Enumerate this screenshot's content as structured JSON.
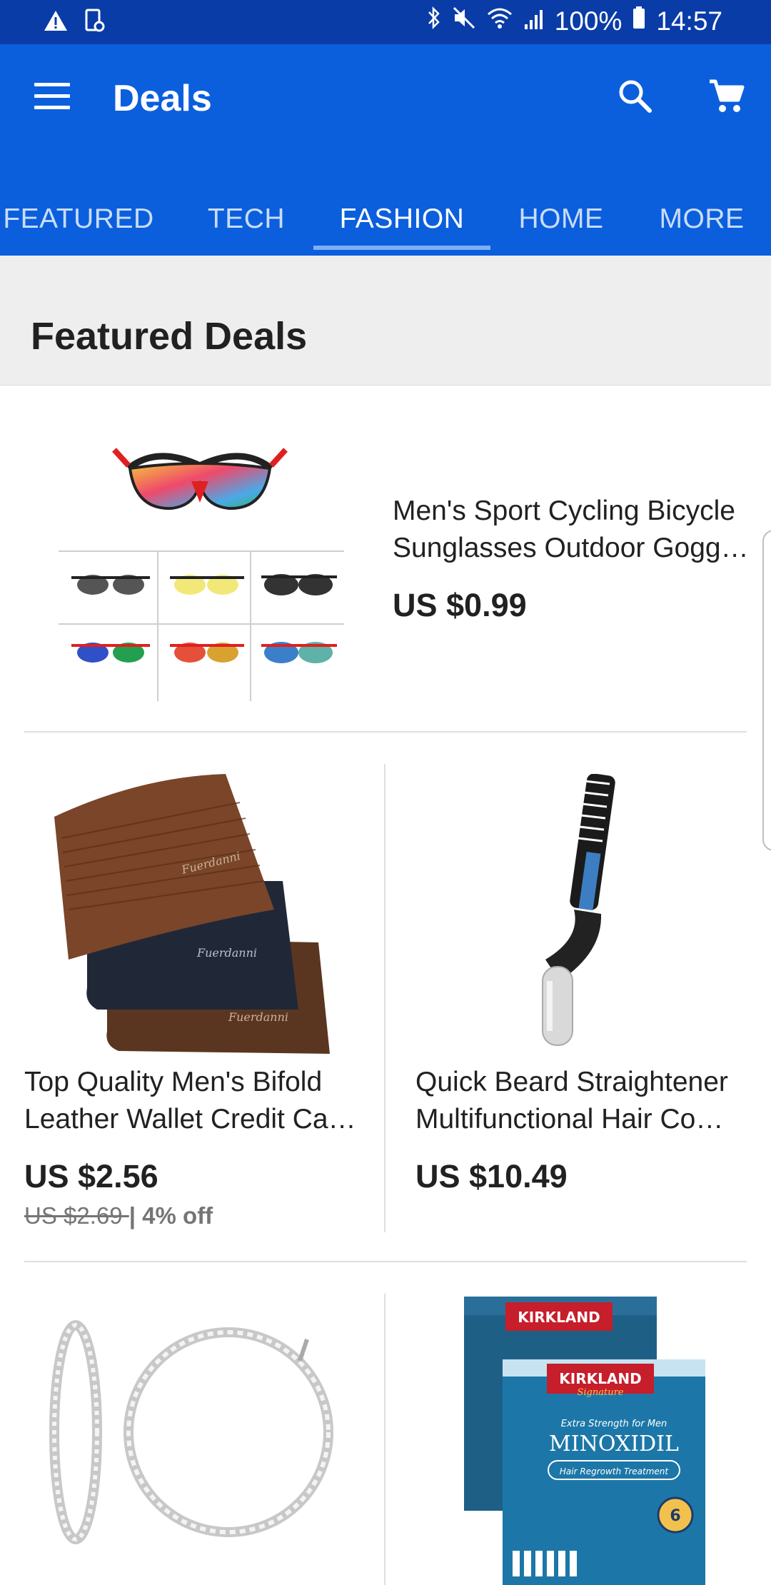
{
  "status": {
    "battery": "100%",
    "time": "14:57"
  },
  "appbar": {
    "title": "Deals"
  },
  "tabs": [
    "FEATURED",
    "TECH",
    "FASHION",
    "HOME",
    "MORE"
  ],
  "active_tab": "FASHION",
  "section": {
    "title": "Featured Deals"
  },
  "products": [
    {
      "title_line1": "Men's Sport Cycling Bicycle",
      "title_line2": "Sunglasses Outdoor Gogg…",
      "price": "US $0.99"
    },
    {
      "title_line1": "Top Quality Men's Bifold",
      "title_line2": "Leather Wallet Credit Ca…",
      "price": "US $2.56",
      "old_price": "US $2.69 ",
      "discount": "| 4% off"
    },
    {
      "title_line1": "Quick Beard Straightener",
      "title_line2": "Multifunctional Hair Co…",
      "price": "US $10.49"
    }
  ],
  "images": {
    "sunglasses": "sunglasses-product-image",
    "wallet": "wallet-product-image",
    "beard": "beard-straightener-product-image",
    "earrings": "hoop-earrings-product-image",
    "minoxidil": "minoxidil-product-image"
  },
  "minoxidil_box": {
    "brand": "KIRKLAND",
    "sub": "Signature",
    "name": "MINOXIDIL",
    "line": "Extra Strength for Men",
    "treat": "Hair Regrowth Treatment"
  },
  "colors": {
    "appbar": "#0b5fdd",
    "statusbar": "#0a3ca8",
    "section_bg": "#eeeeee"
  }
}
